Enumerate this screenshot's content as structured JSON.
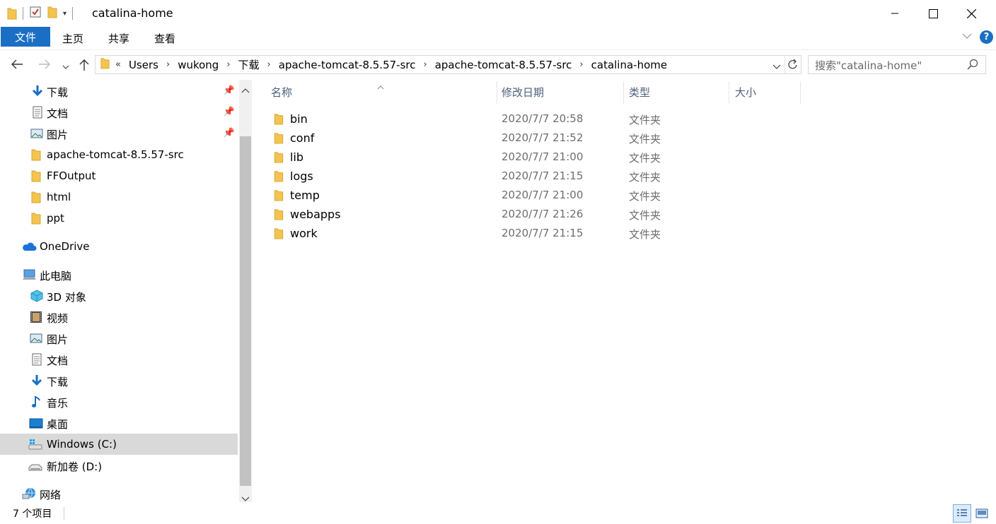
{
  "window": {
    "title": "catalina-home"
  },
  "ribbon": {
    "tabs": [
      "文件",
      "主页",
      "共享",
      "查看"
    ]
  },
  "address": {
    "crumbs": [
      "Users",
      "wukong",
      "下载",
      "apache-tomcat-8.5.57-src",
      "apache-tomcat-8.5.57-src",
      "catalina-home"
    ],
    "overflow": "«"
  },
  "search": {
    "placeholder": "搜索\"catalina-home\""
  },
  "columns": {
    "name": "名称",
    "modified": "修改日期",
    "type": "类型",
    "size": "大小"
  },
  "sidebar": {
    "quick": [
      {
        "label": "下载",
        "icon": "download-arrow-icon",
        "pinned": true
      },
      {
        "label": "文档",
        "icon": "document-icon",
        "pinned": true
      },
      {
        "label": "图片",
        "icon": "picture-icon",
        "pinned": true
      },
      {
        "label": "apache-tomcat-8.5.57-src",
        "icon": "folder-icon"
      },
      {
        "label": "FFOutput",
        "icon": "folder-icon"
      },
      {
        "label": "html",
        "icon": "folder-icon"
      },
      {
        "label": "ppt",
        "icon": "folder-icon"
      }
    ],
    "onedrive": "OneDrive",
    "thispc": "此电脑",
    "pc_items": [
      {
        "label": "3D 对象",
        "icon": "3d-objects-icon"
      },
      {
        "label": "视频",
        "icon": "video-icon"
      },
      {
        "label": "图片",
        "icon": "picture-icon"
      },
      {
        "label": "文档",
        "icon": "document-icon"
      },
      {
        "label": "下载",
        "icon": "download-arrow-icon"
      },
      {
        "label": "音乐",
        "icon": "music-note-icon"
      },
      {
        "label": "桌面",
        "icon": "desktop-icon"
      },
      {
        "label": "Windows (C:)",
        "icon": "windows-drive-icon",
        "selected": true
      },
      {
        "label": "新加卷 (D:)",
        "icon": "drive-icon"
      }
    ],
    "network": "网络"
  },
  "files": [
    {
      "name": "bin",
      "modified": "2020/7/7 20:58",
      "type": "文件夹"
    },
    {
      "name": "conf",
      "modified": "2020/7/7 21:52",
      "type": "文件夹"
    },
    {
      "name": "lib",
      "modified": "2020/7/7 21:00",
      "type": "文件夹"
    },
    {
      "name": "logs",
      "modified": "2020/7/7 21:15",
      "type": "文件夹"
    },
    {
      "name": "temp",
      "modified": "2020/7/7 21:00",
      "type": "文件夹"
    },
    {
      "name": "webapps",
      "modified": "2020/7/7 21:26",
      "type": "文件夹"
    },
    {
      "name": "work",
      "modified": "2020/7/7 21:15",
      "type": "文件夹"
    }
  ],
  "status": {
    "count": "7 个项目"
  },
  "colors": {
    "accent": "#1a6fc4",
    "selection": "#d9d9d9",
    "folder": "#f3c44f"
  }
}
